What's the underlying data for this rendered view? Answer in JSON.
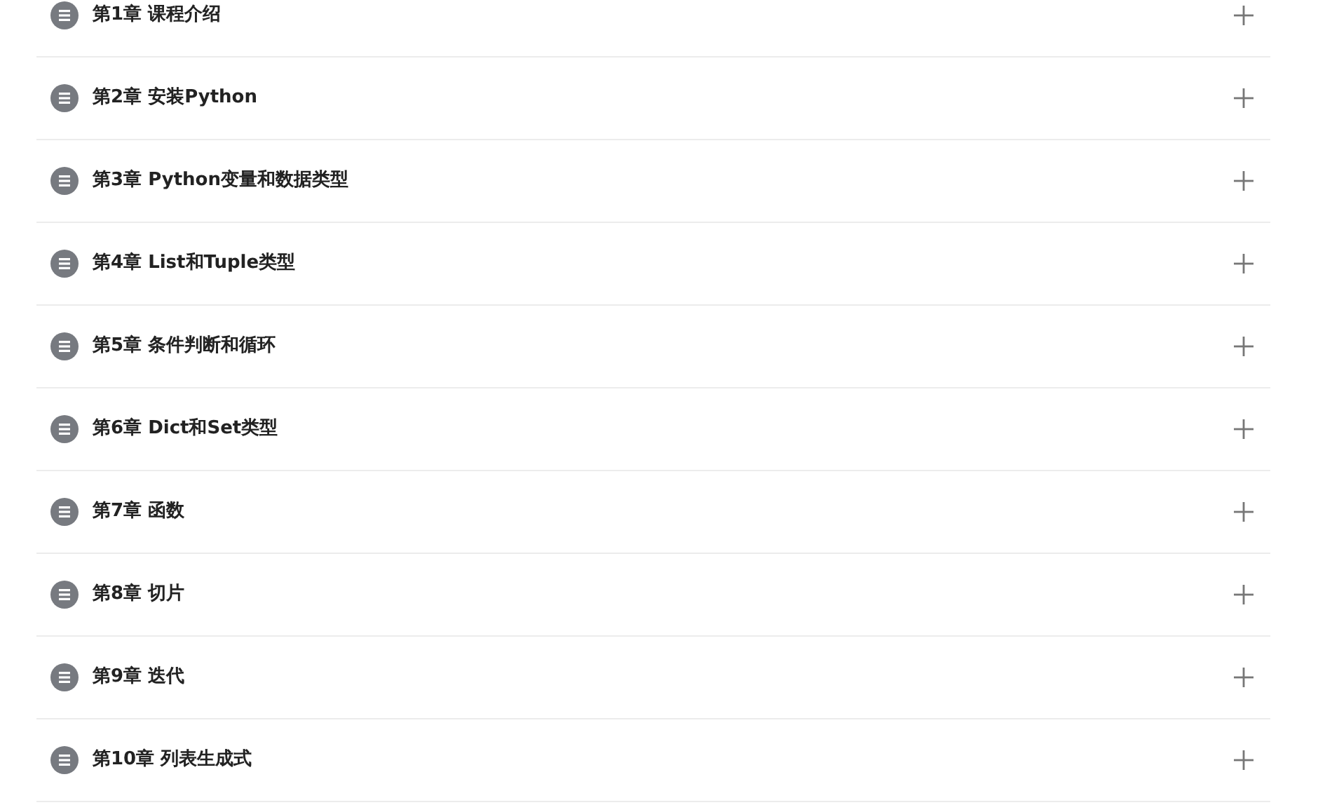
{
  "chapters": [
    {
      "title": "第1章 课程介绍",
      "expanded": false
    },
    {
      "title": "第2章 安装Python",
      "expanded": false
    },
    {
      "title": "第3章 Python变量和数据类型",
      "expanded": false
    },
    {
      "title": "第4章 List和Tuple类型",
      "expanded": false
    },
    {
      "title": "第5章 条件判断和循环",
      "expanded": false
    },
    {
      "title": "第6章 Dict和Set类型",
      "expanded": false
    },
    {
      "title": "第7章 函数",
      "expanded": false
    },
    {
      "title": "第8章 切片",
      "expanded": false
    },
    {
      "title": "第9章 迭代",
      "expanded": false
    },
    {
      "title": "第10章 列表生成式",
      "expanded": false
    }
  ]
}
